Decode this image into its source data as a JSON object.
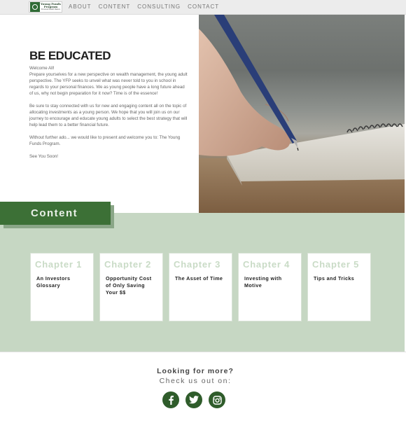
{
  "logo": {
    "title": "Young Funds Program",
    "subtitle": "Personal Wealth Matters"
  },
  "nav": {
    "items": [
      {
        "label": "ABOUT"
      },
      {
        "label": "CONTENT"
      },
      {
        "label": "CONSULTING"
      },
      {
        "label": "CONTACT"
      }
    ]
  },
  "hero": {
    "title": "BE EDUCATED",
    "greeting": "Welcome All!",
    "p1": "Prepare yourselves for a new perspective on wealth management, the young adult perspective. The YFP seeks to unveil what was never told to you in school in regards to your personal finances. We as young people have a long future ahead of us, why not begin preparation for it now? Time is of the essence!",
    "p2": "Be sure to stay connected with us for new and engaging content all on the topic of allocating investments as a young person. We hope that you will join us on our journey to encourage and educate young adults to select the best strategy that will help lead them to a better financial future.",
    "p3": "Without further ado... we would like to present and welcome you to: The Young Funds Program.",
    "p4": "See You Soon!",
    "image_icon": "hand-writing-notebook-photo"
  },
  "content_section": {
    "label": "Content",
    "colors": {
      "band": "#c6d7c3",
      "tab": "#3c7036"
    },
    "chapters": [
      {
        "number": "Chapter 1",
        "title": "An Investors Glossary"
      },
      {
        "number": "Chapter 2",
        "title": "Opportunity Cost of Only Saving Your $$"
      },
      {
        "number": "Chapter 3",
        "title": "The Asset of Time"
      },
      {
        "number": "Chapter 4",
        "title": "Investing with Motive"
      },
      {
        "number": "Chapter 5",
        "title": "Tips and Tricks"
      }
    ]
  },
  "footer": {
    "title": "Looking for more?",
    "subtitle": "Check us out on:",
    "social": [
      {
        "icon": "facebook-icon"
      },
      {
        "icon": "twitter-icon"
      },
      {
        "icon": "instagram-icon"
      }
    ]
  }
}
